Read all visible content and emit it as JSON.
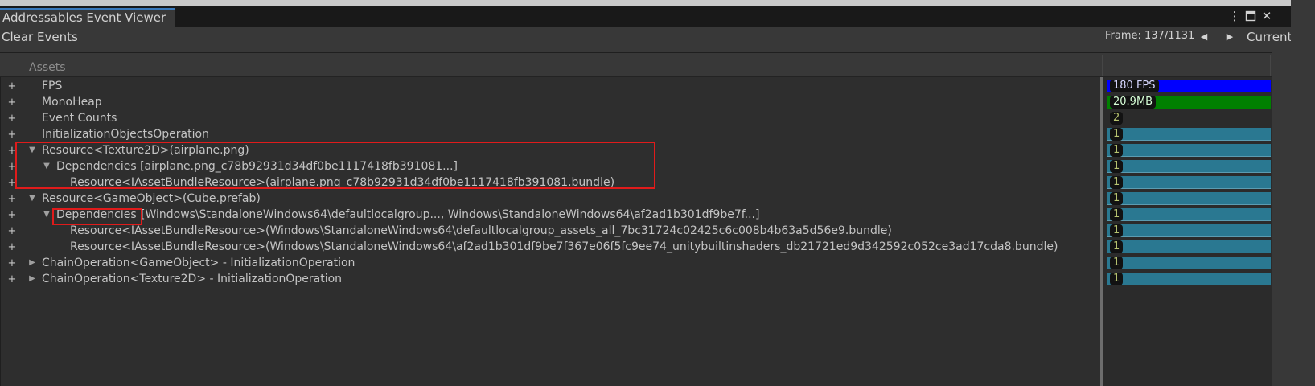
{
  "window": {
    "title": "Addressables Event Viewer"
  },
  "toolbar": {
    "clear_events": "Clear Events",
    "frame": "Frame: 137/1131",
    "current": "Current",
    "prev_icon": "arrow-left-icon",
    "next_icon": "arrow-right-icon"
  },
  "tree": {
    "column_header": "Assets",
    "rows": [
      {
        "label": "FPS",
        "indent": 0,
        "fold": "none",
        "value": "180 FPS",
        "bar": "fps"
      },
      {
        "label": "MonoHeap",
        "indent": 0,
        "fold": "none",
        "value": "20.9MB",
        "bar": "heap"
      },
      {
        "label": "Event Counts",
        "indent": 0,
        "fold": "none",
        "value": "2",
        "bar": "none"
      },
      {
        "label": "InitializationObjectsOperation",
        "indent": 0,
        "fold": "none",
        "value": "1",
        "bar": "dep"
      },
      {
        "label": "Resource<Texture2D>(airplane.png)",
        "indent": 0,
        "fold": "expanded",
        "value": "1",
        "bar": "dep"
      },
      {
        "label": "Dependencies [airplane.png_c78b92931d34df0be1117418fb391081...]",
        "indent": 1,
        "fold": "expanded",
        "value": "1",
        "bar": "dep"
      },
      {
        "label": "Resource<IAssetBundleResource>(airplane.png_c78b92931d34df0be1117418fb391081.bundle)",
        "indent": 2,
        "fold": "none",
        "value": "1",
        "bar": "dep"
      },
      {
        "label": "Resource<GameObject>(Cube.prefab)",
        "indent": 0,
        "fold": "expanded",
        "value": "1",
        "bar": "dep"
      },
      {
        "label": "Dependencies",
        "label_tail": " [Windows\\StandaloneWindows64\\defaultlocalgroup..., Windows\\StandaloneWindows64\\af2ad1b301df9be7f...]",
        "indent": 1,
        "fold": "expanded",
        "value": "1",
        "bar": "dep"
      },
      {
        "label": "Resource<IAssetBundleResource>(Windows\\StandaloneWindows64\\defaultlocalgroup_assets_all_7bc31724c02425c6c008b4b63a5d56e9.bundle)",
        "indent": 2,
        "fold": "none",
        "value": "1",
        "bar": "dep"
      },
      {
        "label": "Resource<IAssetBundleResource>(Windows\\StandaloneWindows64\\af2ad1b301df9be7f367e06f5fc9ee74_unitybuiltinshaders_db21721ed9d342592c052ce3ad17cda8.bundle)",
        "indent": 2,
        "fold": "none",
        "value": "1",
        "bar": "dep"
      },
      {
        "label": "ChainOperation<GameObject> - InitializationOperation",
        "indent": 0,
        "fold": "collapsed",
        "value": "1",
        "bar": "dep"
      },
      {
        "label": "ChainOperation<Texture2D> - InitializationOperation",
        "indent": 0,
        "fold": "collapsed",
        "value": "1",
        "bar": "dep"
      }
    ]
  },
  "colors": {
    "fps_bar": "#0000ff",
    "heap_bar": "#008000",
    "dep_bar": "#2a7891",
    "highlight": "#e01b1b",
    "fps_text": "#d7d7ff",
    "heap_text": "#d7ffd7",
    "count_text": "#b8c470"
  }
}
